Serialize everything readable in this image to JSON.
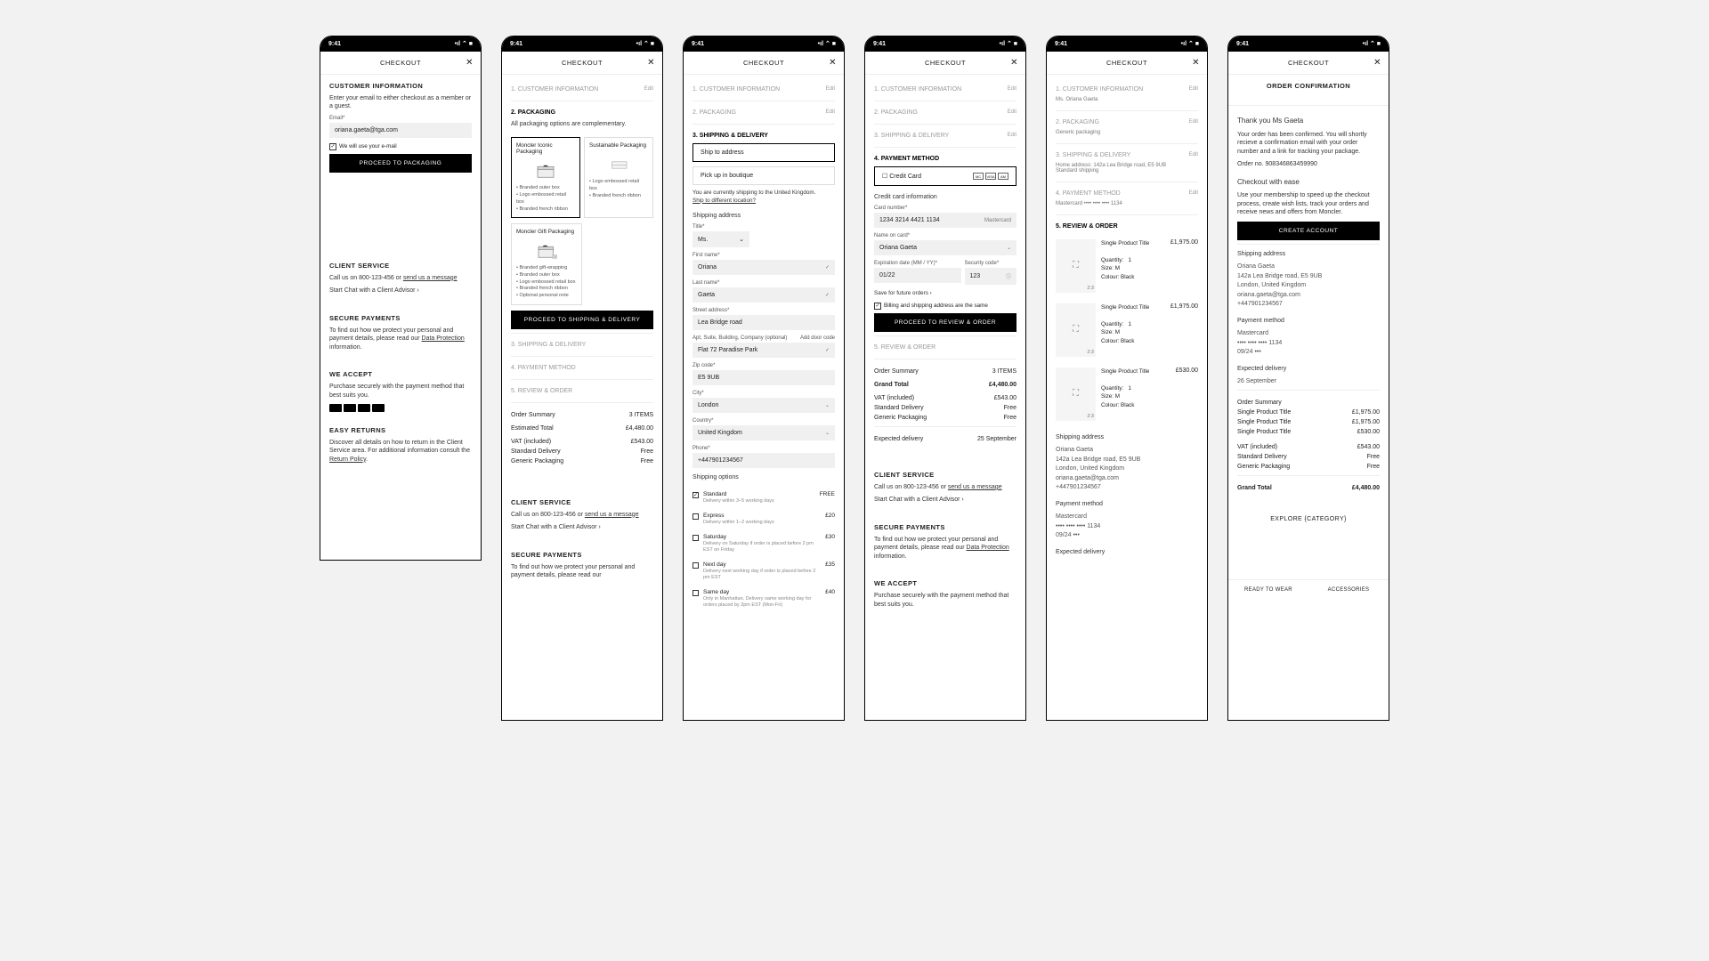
{
  "time": "9:41",
  "hdr": "CHECKOUT",
  "s1": {
    "t": "CUSTOMER INFORMATION",
    "d": "Enter your email to either checkout as a member or a guest.",
    "el": "Email*",
    "ev": "oriana.gaeta@tga.com",
    "chk": "We will use your e-mail",
    "btn": "PROCEED TO PACKAGING"
  },
  "cs": {
    "t": "CLIENT SERVICE",
    "d": "Call us on 800-123-456 or ",
    "lnk": "send us a message",
    "chat": "Start Chat with a Client Advisor  ›"
  },
  "sp": {
    "t": "SECURE PAYMENTS",
    "d": "To find out how we protect your personal and payment details, please read our ",
    "lnk": "Data Protection",
    "d2": " information."
  },
  "wa": {
    "t": "WE ACCEPT",
    "d": "Purchase securely with the payment method that best suits you."
  },
  "er": {
    "t": "EASY RETURNS",
    "d": "Discover all details on how to return in the Client Service area. For additional information consult the ",
    "lnk": "Return Policy",
    "d2": "."
  },
  "steps": {
    "s1": "1. CUSTOMER INFORMATION",
    "s2": "2. PACKAGING",
    "s3": "3. SHIPPING & DELIVERY",
    "s4": "4. PAYMENT METHOD",
    "s5": "5. REVIEW & ORDER",
    "ed": "Edit"
  },
  "pk": {
    "note": "All packaging options are complementary.",
    "p1": "Moncler Iconic Packaging",
    "p2": "Sustainable Packaging",
    "p3": "Moncler Gift Packaging",
    "b1a": "Branded outer box",
    "b1b": "Logo embossed retail box",
    "b1c": "Branded french ribbon",
    "b3a": "Branded gift-wrapping",
    "b3b": "Branded outer box",
    "b3c": "Logo embossed retail box",
    "b3d": "Branded french ribbon",
    "b3e": "Optional personal note",
    "btn": "PROCEED TO SHIPPING & DELIVERY"
  },
  "os": {
    "t": "Order Summary",
    "n": "3 ITEMS",
    "et": "Estimated Total",
    "gt": "Grand Total",
    "tot": "£4,480.00",
    "vat": "VAT (included)",
    "vatv": "£543.00",
    "sd": "Standard Delivery",
    "sdv": "Free",
    "gp": "Generic Packaging",
    "gpv": "Free",
    "exp": "Expected delivery",
    "expv": "25 September"
  },
  "sh": {
    "o1": "Ship to address",
    "o2": "Pick up in boutique",
    "note": "You are currently shipping to the United Kingdom.",
    "lnk": "Ship to different location?",
    "sa": "Shipping address",
    "ti": "Title*",
    "tiv": "Ms.",
    "fn": "First name*",
    "fnv": "Oriana",
    "ln": "Last name*",
    "lnv": "Gaeta",
    "st": "Street address*",
    "stv": "Lea Bridge road",
    "ap": "Apt, Suite, Building, Company (optional)",
    "apv": "Flat 72 Paradise Park",
    "dc": "Add door code",
    "zp": "Zip code*",
    "zpv": "E5 9UB",
    "ct": "City*",
    "ctv": "London",
    "co": "Country*",
    "cov": "United Kingdom",
    "ph": "Phone*",
    "phv": "+447901234567",
    "so": "Shipping options",
    "sp1": "Standard",
    "sp1d": "Delivery within 3–5  working days",
    "sp1p": "FREE",
    "sp2": "Express",
    "sp2d": "Delivery within  1–2 working days",
    "sp2p": "£20",
    "sp3": "Saturday",
    "sp3d": "Delivery on Saturday if order is placed before 2 pm EST on Friday",
    "sp3p": "£30",
    "sp4": "Next day",
    "sp4d": "Delivery next working day if order is placed before 2 pm EST",
    "sp4p": "£35",
    "sp5": "Same day",
    "sp5d": "Only in Manhattan. Delivery same working day for orders placed by 2pm EST (Mon-Fri)",
    "sp5p": "£40"
  },
  "pm": {
    "cc": "Credit Card",
    "cci": "Credit card information",
    "cn": "Card number*",
    "cnv": "1234 3214 4421 1134",
    "br": "Mastercard",
    "nc": "Name on card*",
    "ncv": "Oriana Gaeta",
    "ex": "Expiration date (MM / YY)*",
    "exv": "01/22",
    "sc": "Security code*",
    "scv": "123",
    "sf": "Save for future orders ›",
    "bl": "Billing and shipping address are the same",
    "btn": "PROCEED TO REVIEW & ORDER"
  },
  "rv": {
    "name": "Ms. Oriana Gaeta",
    "pk": "Generic packaging",
    "addr": "Home address: 142a Lea Bridge road, E5 9UB",
    "ship": "Standard shipping",
    "mc": "Mastercard  •••• •••• •••• 1134",
    "pt": "Single Product Title",
    "pr1": "£1,975.00",
    "pr2": "£530.00",
    "q": "Quantity:",
    "qv": "1",
    "sz": "Size:  M",
    "cl": "Colour:  Black",
    "ratio": "2:3",
    "sat": "Shipping address",
    "a1": "Oriana Gaeta",
    "a2": "142a Lea Bridge road, E5 9UB",
    "a3": "London, United Kingdom",
    "a4": "oriana.gaeta@tga.com",
    "a5": "+447901234567",
    "pmt": "Payment method",
    "m1": "Mastercard",
    "m2": "•••• •••• •••• 1134",
    "m3": "09/24    •••",
    "edt": "Expected delivery"
  },
  "oc": {
    "t": "ORDER CONFIRMATION",
    "ty": "Thank you Ms Gaeta",
    "d": "Your order has been confirmed. You will shortly recieve a confirmation email with your order number and a link for tracking your package.",
    "on": "Order no. 908346863459990",
    "ce": "Checkout with ease",
    "ced": "Use your membership to speed up the checkout process, create wish lists, track your orders and receive news and offers from Moncler.",
    "btn": "CREATE ACCOUNT",
    "ed": "Expected delivery",
    "edv": "26 September",
    "explore": "EXPLORE {CATEGORY}",
    "t1": "READY TO WEAR",
    "t2": "ACCESSORIES"
  }
}
